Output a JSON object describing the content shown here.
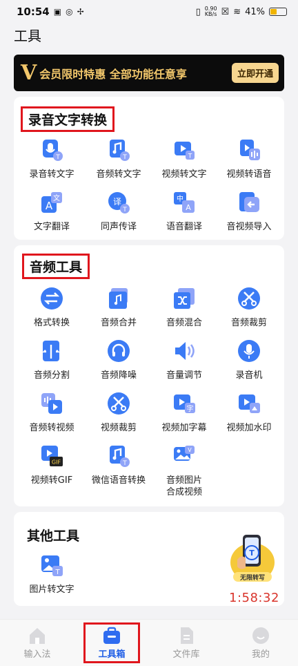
{
  "status_bar": {
    "time": "10:54",
    "net_speed_value": "0.90",
    "net_speed_unit": "KB/s",
    "battery": "41%"
  },
  "page": {
    "title": "工具"
  },
  "banner": {
    "logo": "V",
    "slogan": "会员限时特惠  全部功能任意享",
    "button": "立即开通"
  },
  "sections": [
    {
      "title": "录音文字转换",
      "tools": [
        "录音转文字",
        "音频转文字",
        "视频转文字",
        "视频转语音",
        "文字翻译",
        "同声传译",
        "语音翻译",
        "音视频导入"
      ]
    },
    {
      "title": "音频工具",
      "tools": [
        "格式转换",
        "音频合并",
        "音频混合",
        "音频裁剪",
        "音频分割",
        "音频降噪",
        "音量调节",
        "录音机",
        "音频转视频",
        "视频裁剪",
        "视频加字幕",
        "视频加水印",
        "视频转GIF",
        "微信语音转换",
        "音频图片",
        "合成视频"
      ]
    },
    {
      "title": "其他工具",
      "tools": [
        "图片转文字"
      ]
    }
  ],
  "promo": {
    "label": "无限转写",
    "timer": "1:58:32"
  },
  "tabs": [
    "输入法",
    "工具箱",
    "文件库",
    "我的"
  ],
  "colors": {
    "accent": "#1f5ee6",
    "highlight_box": "#e0161d",
    "banner_gold": "#f2c76b"
  }
}
